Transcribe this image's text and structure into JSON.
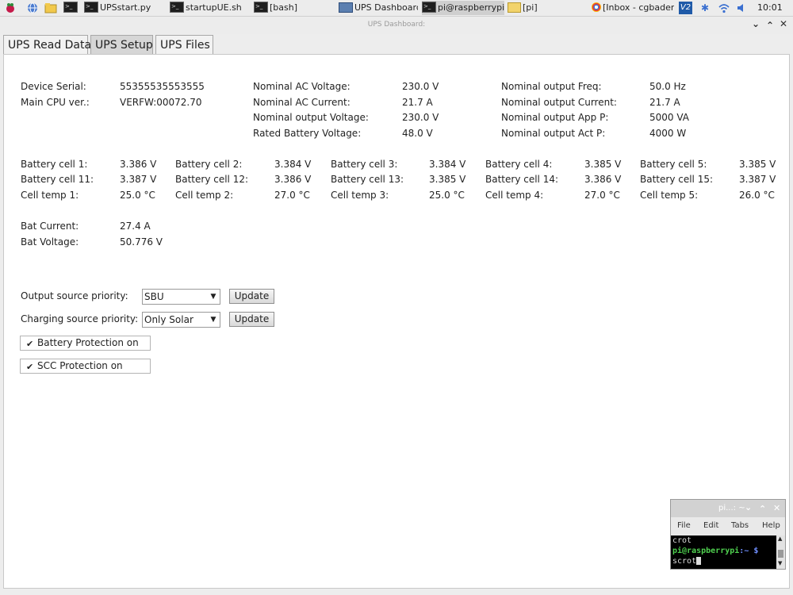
{
  "taskbar": {
    "items": [
      {
        "label": "UPSstart.py"
      },
      {
        "label": "startupUE.sh"
      },
      {
        "label": "[bash]"
      },
      {
        "label": "UPS Dashboard:"
      },
      {
        "label": "pi@raspberrypi: ..."
      },
      {
        "label": "[pi]"
      },
      {
        "label": "[Inbox - cgbaden..."
      }
    ],
    "clock": "10:01",
    "colors": {
      "bar": "#ececec",
      "active": "#cfcfcf"
    }
  },
  "window": {
    "title": "UPS Dashboard:"
  },
  "tabs": [
    {
      "label": "UPS Read Data"
    },
    {
      "label": "UPS Setup"
    },
    {
      "label": "UPS Files"
    }
  ],
  "device": {
    "serial_label": "Device Serial:",
    "serial_value": "55355535553555",
    "cpu_label": "Main CPU ver.:",
    "cpu_value": "VERFW:00072.70"
  },
  "nominal_left": [
    {
      "label": "Nominal AC Voltage:",
      "value": "230.0 V"
    },
    {
      "label": "Nominal AC Current:",
      "value": "21.7 A"
    },
    {
      "label": "Nominal output Voltage:",
      "value": "230.0 V"
    },
    {
      "label": "Rated Battery Voltage:",
      "value": "48.0 V"
    }
  ],
  "nominal_right": [
    {
      "label": "Nominal output Freq:",
      "value": "50.0 Hz"
    },
    {
      "label": "Nominal output Current:",
      "value": "21.7 A"
    },
    {
      "label": "Nominal output App P:",
      "value": "5000 VA"
    },
    {
      "label": "Nominal output Act P:",
      "value": "4000 W"
    }
  ],
  "cells": [
    [
      {
        "label": "Battery cell 1:",
        "value": "3.386 V"
      },
      {
        "label": "Battery cell 2:",
        "value": "3.384 V"
      },
      {
        "label": "Battery cell 3:",
        "value": "3.384 V"
      },
      {
        "label": "Battery cell 4:",
        "value": "3.385 V"
      },
      {
        "label": "Battery cell 5:",
        "value": "3.385 V"
      }
    ],
    [
      {
        "label": "Battery cell 11:",
        "value": "3.387 V"
      },
      {
        "label": "Battery cell 12:",
        "value": "3.386 V"
      },
      {
        "label": "Battery cell 13:",
        "value": "3.385 V"
      },
      {
        "label": "Battery cell 14:",
        "value": "3.386 V"
      },
      {
        "label": "Battery cell 15:",
        "value": "3.387 V"
      }
    ],
    [
      {
        "label": "Cell temp 1:",
        "value": "25.0 °C"
      },
      {
        "label": "Cell temp 2:",
        "value": "27.0 °C"
      },
      {
        "label": "Cell temp 3:",
        "value": "25.0 °C"
      },
      {
        "label": "Cell temp 4:",
        "value": "27.0 °C"
      },
      {
        "label": "Cell temp 5:",
        "value": "26.0 °C"
      }
    ]
  ],
  "battery": {
    "current_label": "Bat Current:",
    "current_value": "27.4 A",
    "voltage_label": "Bat Voltage:",
    "voltage_value": "50.776 V"
  },
  "setup": {
    "output_priority_label": "Output source priority:",
    "output_priority_value": "SBU",
    "charging_priority_label": "Charging source priority:",
    "charging_priority_value": "Only Solar",
    "update_label": "Update",
    "battery_protection_label": "Battery Protection on",
    "battery_protection_checked": true,
    "scc_protection_label": "SCC Protection on",
    "scc_protection_checked": true
  },
  "terminal": {
    "title": "pi...: ~",
    "menu": [
      "File",
      "Edit",
      "Tabs",
      "Help"
    ],
    "line1": "crot",
    "prompt_user": "pi@raspberrypi",
    "prompt_rest": ":~ $",
    "line3": "scrot"
  }
}
